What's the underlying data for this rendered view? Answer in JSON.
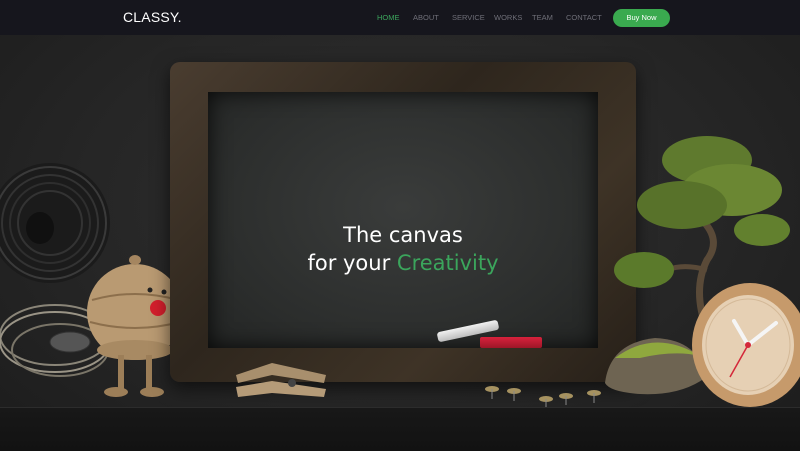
{
  "nav": {
    "logo": "CLASSY.",
    "items": [
      {
        "label": "HOME",
        "active": true
      },
      {
        "label": "ABOUT",
        "active": false
      },
      {
        "label": "SERVICE",
        "active": false
      },
      {
        "label": "WORKS",
        "active": false
      },
      {
        "label": "TEAM",
        "active": false
      },
      {
        "label": "CONTACT",
        "active": false
      }
    ],
    "buy_label": "Buy Now"
  },
  "hero": {
    "line1": "The canvas",
    "line2_prefix": "for your ",
    "line2_accent": "Creativity"
  },
  "colors": {
    "accent": "#3ba55c",
    "nav_bg": "#16161d",
    "button": "#3aaa4f",
    "chalk_red": "#c81e35"
  }
}
